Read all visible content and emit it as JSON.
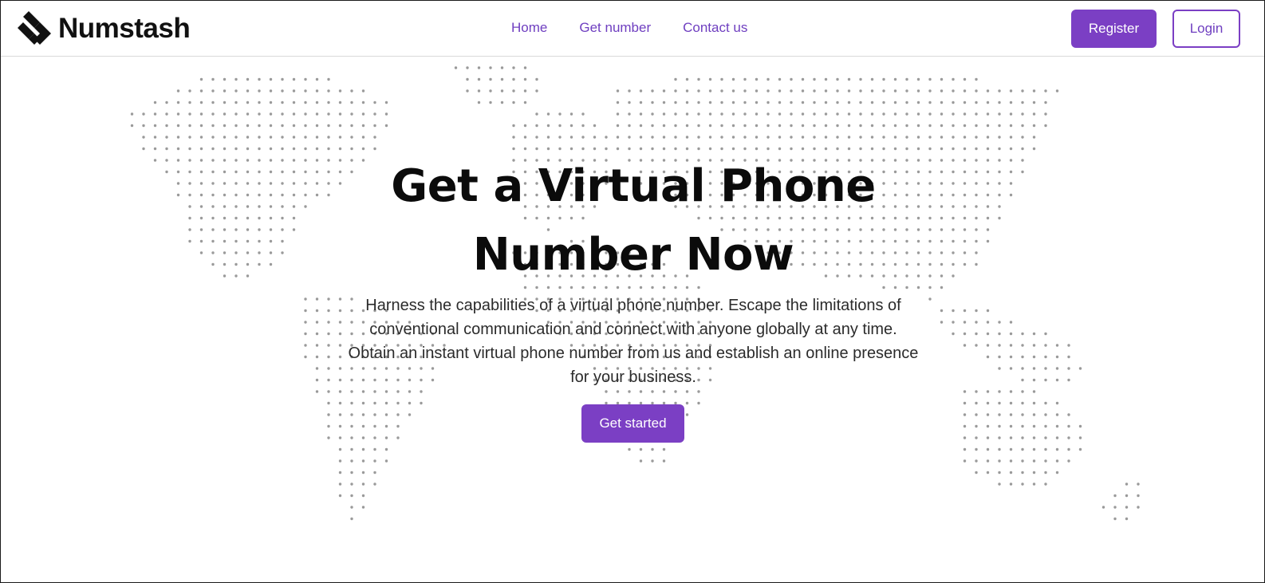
{
  "brand": {
    "name": "Numstash",
    "logo_icon": "numstash-logo-icon"
  },
  "nav": {
    "links": [
      {
        "label": "Home"
      },
      {
        "label": "Get number"
      },
      {
        "label": "Contact us"
      }
    ],
    "register_label": "Register",
    "login_label": "Login"
  },
  "hero": {
    "title_line1": "Get a Virtual Phone",
    "title_line2": "Number Now",
    "description": "Harness the capabilities of a virtual phone number. Escape the limitations of conventional communication and connect with anyone globally at any time. Obtain an instant virtual phone number from us and establish an online presence for your business.",
    "cta_label": "Get started",
    "background_icon": "world-map-dots-icon"
  },
  "colors": {
    "accent": "#7b3fc4",
    "link": "#6f3fc0",
    "text": "#0b0b0b",
    "map_dot": "#9a9a9a"
  }
}
